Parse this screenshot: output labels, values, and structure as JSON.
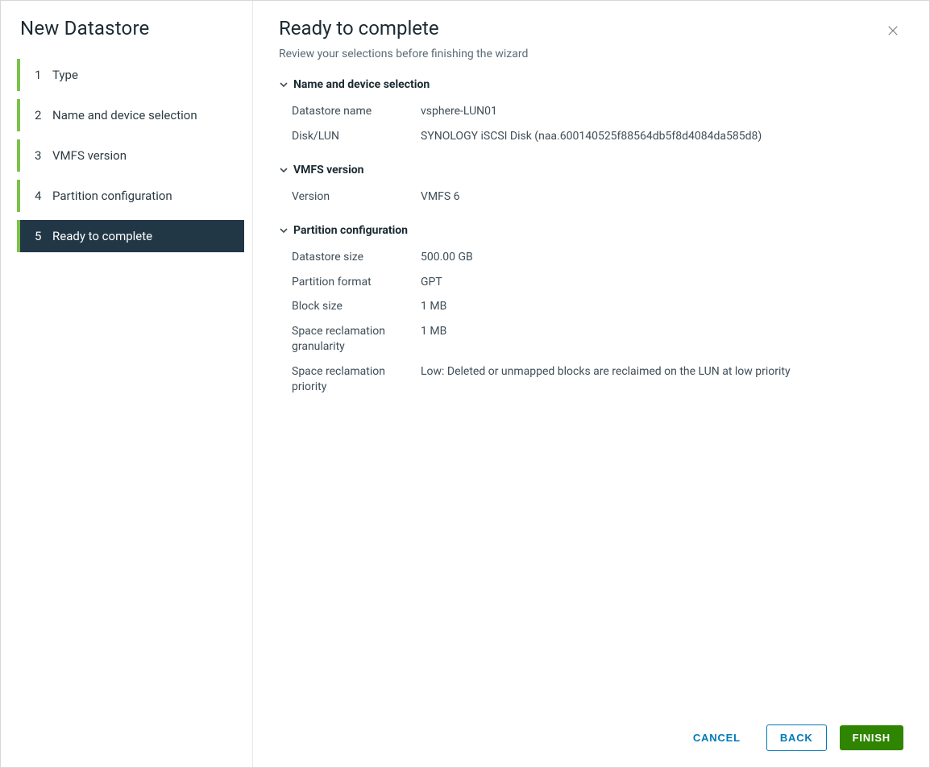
{
  "wizard": {
    "title": "New Datastore",
    "steps": [
      {
        "num": "1",
        "label": "Type",
        "active": false
      },
      {
        "num": "2",
        "label": "Name and device selection",
        "active": false
      },
      {
        "num": "3",
        "label": "VMFS version",
        "active": false
      },
      {
        "num": "4",
        "label": "Partition configuration",
        "active": false
      },
      {
        "num": "5",
        "label": "Ready to complete",
        "active": true
      }
    ]
  },
  "page": {
    "title": "Ready to complete",
    "subtitle": "Review your selections before finishing the wizard"
  },
  "sections": {
    "nameDevice": {
      "header": "Name and device selection",
      "rows": {
        "datastoreName": {
          "label": "Datastore name",
          "value": "vsphere-LUN01"
        },
        "diskLun": {
          "label": "Disk/LUN",
          "value": "SYNOLOGY iSCSI Disk (naa.600140525f88564db5f8d4084da585d8)"
        }
      }
    },
    "vmfs": {
      "header": "VMFS version",
      "rows": {
        "version": {
          "label": "Version",
          "value": "VMFS 6"
        }
      }
    },
    "partition": {
      "header": "Partition configuration",
      "rows": {
        "size": {
          "label": "Datastore size",
          "value": "500.00 GB"
        },
        "format": {
          "label": "Partition format",
          "value": "GPT"
        },
        "block": {
          "label": "Block size",
          "value": "1 MB"
        },
        "granularity": {
          "label": "Space reclamation granularity",
          "value": "1 MB"
        },
        "priority": {
          "label": "Space reclamation priority",
          "value": "Low: Deleted or unmapped blocks are reclaimed on the LUN at low priority"
        }
      }
    }
  },
  "footer": {
    "cancel": "CANCEL",
    "back": "BACK",
    "finish": "FINISH"
  }
}
